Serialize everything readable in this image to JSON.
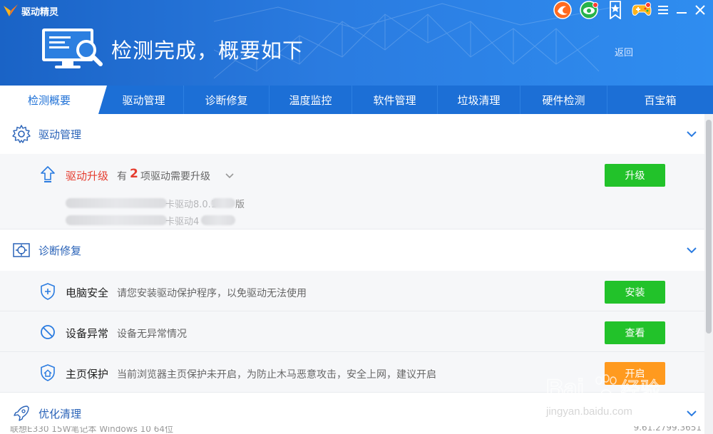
{
  "app": {
    "brand": "驱动精灵",
    "banner_title": "检测完成，概要如下",
    "back_label": "返回"
  },
  "top_icons": [
    {
      "icon": "orange-swirl-icon"
    },
    {
      "icon": "green-eye-icon"
    },
    {
      "icon": "medal-icon"
    },
    {
      "icon": "gamepad-icon"
    }
  ],
  "tabs": [
    {
      "label": "检测概要",
      "active": true
    },
    {
      "label": "驱动管理"
    },
    {
      "label": "诊断修复"
    },
    {
      "label": "温度监控"
    },
    {
      "label": "软件管理"
    },
    {
      "label": "垃圾清理"
    },
    {
      "label": "硬件检测"
    },
    {
      "label": "百宝箱"
    }
  ],
  "driver_section": {
    "title": "驱动管理",
    "upgrade": {
      "title": "驱动升级",
      "prefix": "有",
      "count": "2",
      "suffix": "项驱动需要升级",
      "button": "升级",
      "items": [
        {
          "visible_text": "卡驱动8.0.1",
          "tail": "版"
        },
        {
          "visible_text": "卡驱动4",
          "tail": ""
        }
      ]
    }
  },
  "diagnose_section": {
    "title": "诊断修复",
    "rows": [
      {
        "title": "电脑安全",
        "desc": "请您安装驱动保护程序，以免驱动无法使用",
        "button": "安装"
      },
      {
        "title": "设备异常",
        "desc": "设备无异常情况",
        "button": "查看"
      },
      {
        "title": "主页保护",
        "desc": "当前浏览器主页保护未开启，为防止木马恶意攻击，安全上网，建议开启",
        "button": "开启"
      }
    ]
  },
  "optimize_section": {
    "title": "优化清理"
  },
  "statusbar": {
    "left": "联想E330 15W笔记本 Windows 10 64位",
    "right": "9.61.2799.3651"
  },
  "watermark": {
    "logo": "Bai du 经验",
    "url": "jingyan.baidu.com"
  },
  "colors": {
    "header": "#2a7be0",
    "tab_bar": "#1c6fd6",
    "accent_text": "#2a63b8",
    "green_button": "#22c22a",
    "orange_button": "#ff9a1f",
    "upgrade_red": "#e53d2f"
  }
}
